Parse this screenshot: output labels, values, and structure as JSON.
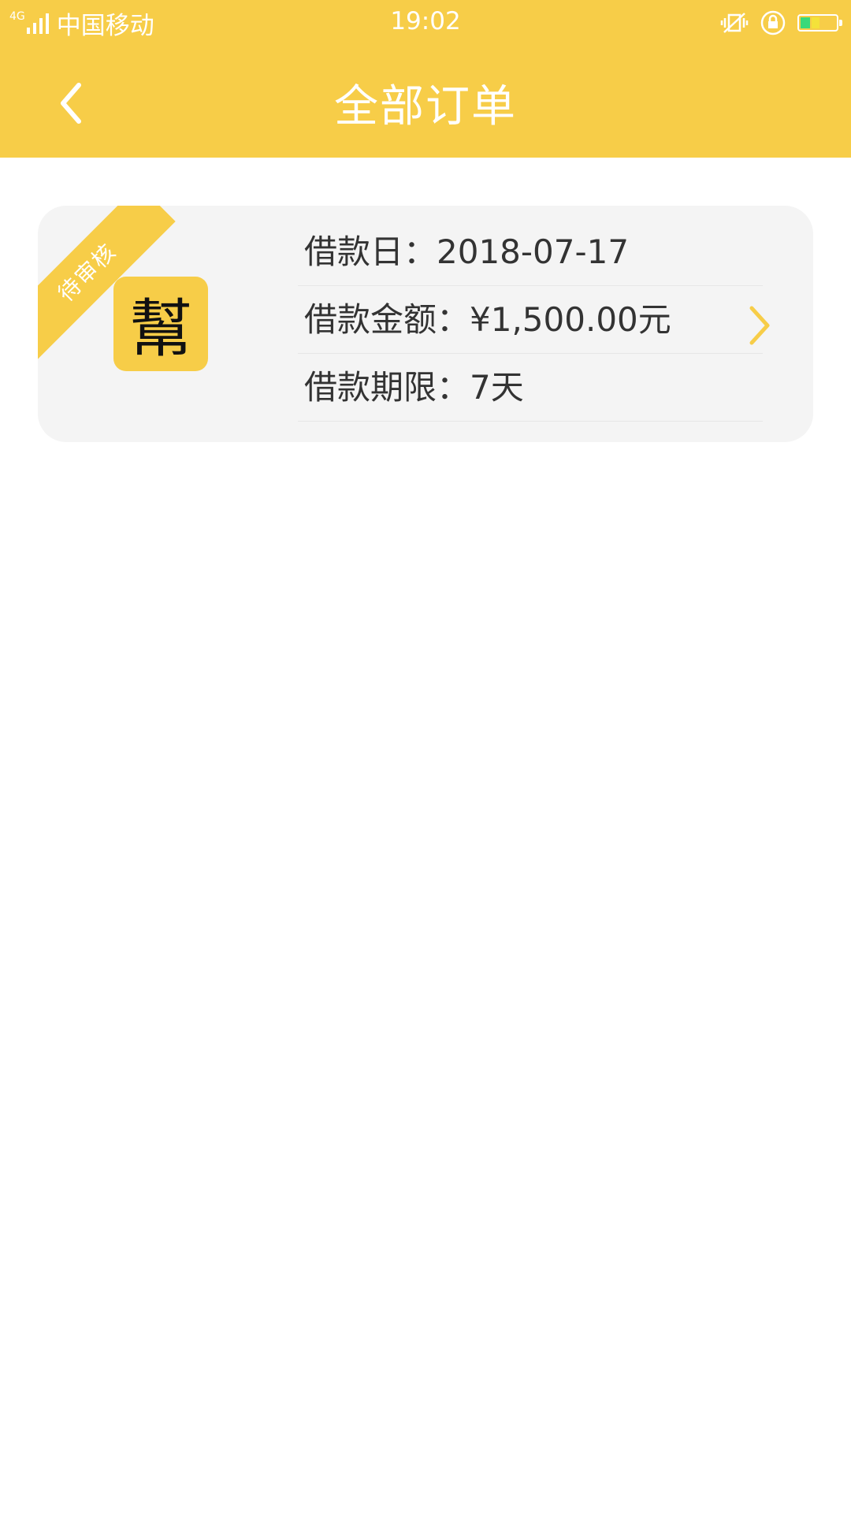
{
  "status_bar": {
    "network": "4G",
    "carrier": "中国移动",
    "time": "19:02",
    "icons": [
      "signal-icon",
      "vibrate-icon",
      "rotation-lock-icon",
      "battery-icon"
    ]
  },
  "header": {
    "title": "全部订单",
    "back_icon": "back-arrow-icon",
    "color": "#F7CD48"
  },
  "order": {
    "status_ribbon": "待审核",
    "app_logo_char": "幫",
    "rows": [
      {
        "label": "借款日：",
        "value": "2018-07-17"
      },
      {
        "label": "借款金额：",
        "value": "¥1,500.00元"
      },
      {
        "label": "借款期限：",
        "value": "7天"
      }
    ],
    "detail_icon": "chevron-right-icon"
  }
}
